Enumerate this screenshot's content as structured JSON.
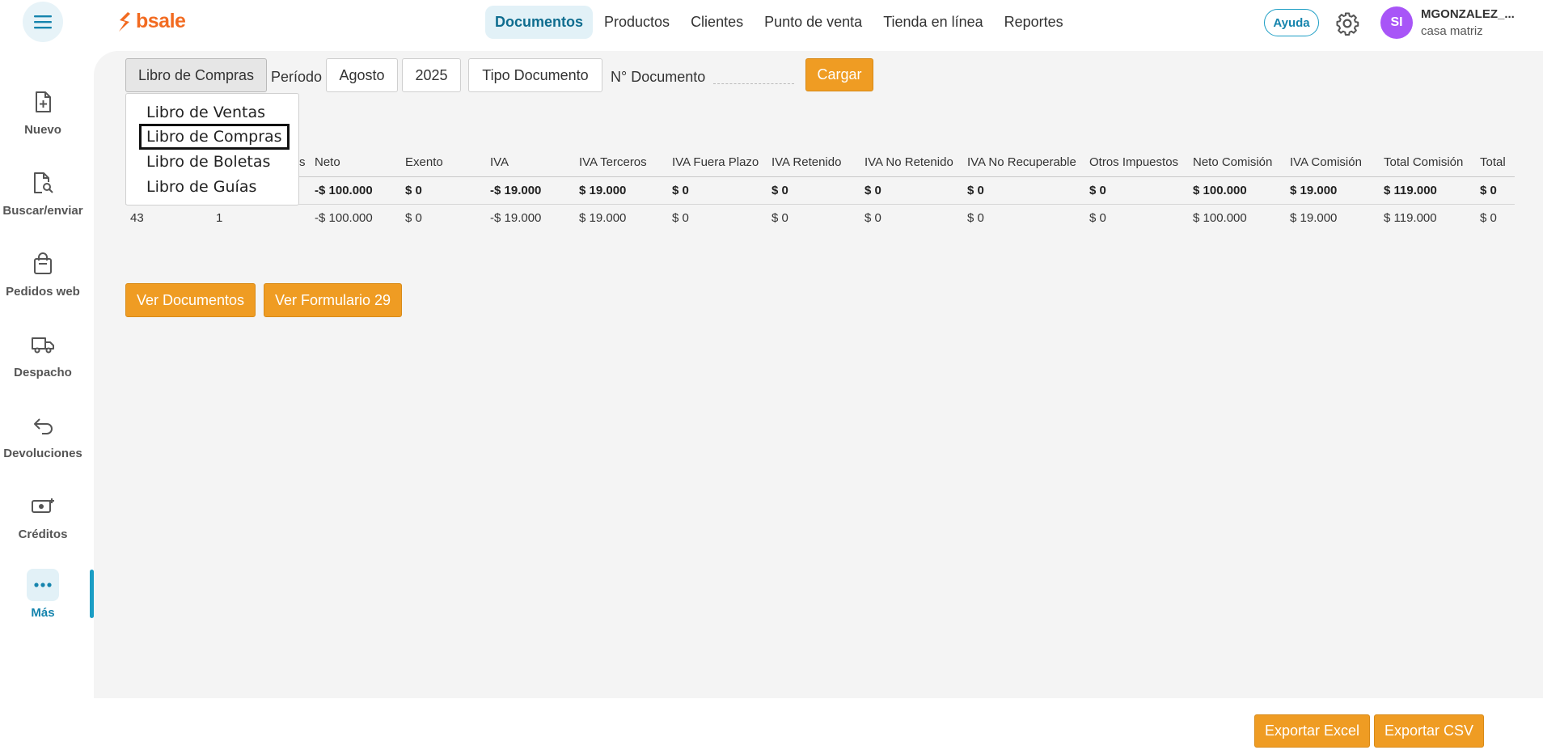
{
  "brand": {
    "name": "bsale",
    "color": "#f26b21"
  },
  "topnav": {
    "items": [
      {
        "label": "Documentos",
        "active": true
      },
      {
        "label": "Productos",
        "active": false
      },
      {
        "label": "Clientes",
        "active": false
      },
      {
        "label": "Punto de venta",
        "active": false
      },
      {
        "label": "Tienda en línea",
        "active": false
      },
      {
        "label": "Reportes",
        "active": false
      }
    ],
    "help_label": "Ayuda",
    "settings_icon": "gear-icon"
  },
  "user": {
    "initials": "SI",
    "name": "MGONZALEZ_...",
    "branch": "casa matriz",
    "avatar_color": "#a855f7"
  },
  "sidebar": {
    "items": [
      {
        "label": "Nuevo",
        "icon": "new-document-icon"
      },
      {
        "label": "Buscar/enviar",
        "icon": "search-document-icon"
      },
      {
        "label": "Pedidos web",
        "icon": "shopping-bag-icon"
      },
      {
        "label": "Despacho",
        "icon": "truck-icon"
      },
      {
        "label": "Devoluciones",
        "icon": "return-arrow-icon"
      },
      {
        "label": "Créditos",
        "icon": "cash-plus-icon"
      },
      {
        "label": "Más",
        "icon": "more-dots-icon",
        "active": true
      }
    ]
  },
  "filters": {
    "book_selected": "Libro de Compras",
    "period_label": "Período",
    "month": "Agosto",
    "year": "2025",
    "doc_type": "Tipo Documento",
    "doc_number_label": "N° Documento",
    "doc_number_value": "",
    "load_button": "Cargar"
  },
  "book_dropdown": {
    "options": [
      "Libro de Ventas",
      "Libro de Compras",
      "Libro de Boletas",
      "Libro de Guías"
    ],
    "selected_index": 1
  },
  "table": {
    "partial_header_fragment": "s",
    "headers": [
      "Neto",
      "Exento",
      "IVA",
      "IVA Terceros",
      "IVA Fuera Plazo",
      "IVA Retenido",
      "IVA No Retenido",
      "IVA No Recuperable",
      "Otros Impuestos",
      "Neto Comisión",
      "IVA Comisión",
      "Total Comisión",
      "Total"
    ],
    "totals_row": [
      "-$ 100.000",
      "$ 0",
      "-$ 19.000",
      "$ 19.000",
      "$ 0",
      "$ 0",
      "$ 0",
      "$ 0",
      "$ 0",
      "$ 100.000",
      "$ 19.000",
      "$ 119.000",
      "$ 0"
    ],
    "rows": [
      {
        "type_code": "43",
        "count": "1",
        "values": [
          "-$ 100.000",
          "$ 0",
          "-$ 19.000",
          "$ 19.000",
          "$ 0",
          "$ 0",
          "$ 0",
          "$ 0",
          "$ 0",
          "$ 100.000",
          "$ 19.000",
          "$ 119.000",
          "$ 0"
        ]
      }
    ]
  },
  "actions": {
    "view_documents": "Ver Documentos",
    "view_form29": "Ver Formulario 29",
    "export_excel": "Exportar Excel",
    "export_csv": "Exportar CSV"
  },
  "accent_color": "#ef9c23"
}
